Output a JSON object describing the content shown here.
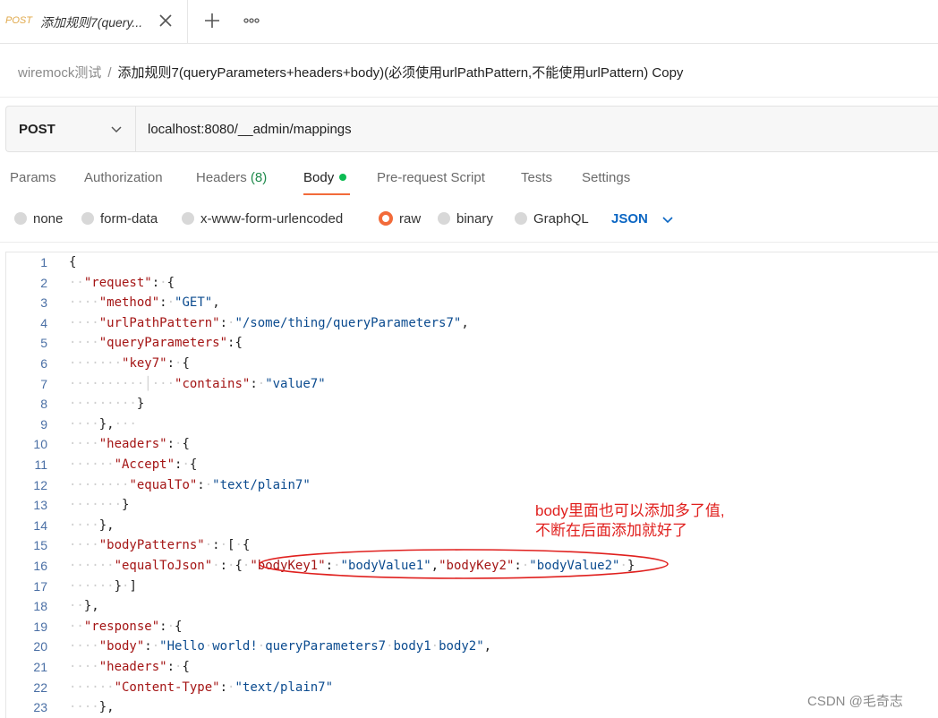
{
  "tab": {
    "method": "POST",
    "title": "添加规则7(query..."
  },
  "icons": {
    "close": "close-icon",
    "new_tab": "plus-icon",
    "more": "more-icon"
  },
  "breadcrumb": {
    "parent": "wiremock测试",
    "separator": "/",
    "current": "添加规则7(queryParameters+headers+body)(必须使用urlPathPattern,不能使用urlPattern) Copy"
  },
  "request": {
    "method": "POST",
    "url": "localhost:8080/__admin/mappings"
  },
  "request_tabs": [
    {
      "label": "Params"
    },
    {
      "label": "Authorization"
    },
    {
      "label": "Headers",
      "count": "(8)"
    },
    {
      "label": "Body"
    },
    {
      "label": "Pre-request Script"
    },
    {
      "label": "Tests"
    },
    {
      "label": "Settings"
    }
  ],
  "body_types": [
    "none",
    "form-data",
    "x-www-form-urlencoded",
    "raw",
    "binary",
    "GraphQL"
  ],
  "body_type_selected": "raw",
  "language": "JSON",
  "colors": {
    "accent": "#f26b3a",
    "active_dot": "#0cbb52",
    "json_key": "#a41515",
    "json_string": "#0b4b8f",
    "annotation": "#e0201e"
  },
  "code_lines": [
    {
      "n": "1",
      "ind": "",
      "html": "{"
    },
    {
      "n": "2",
      "ind": "··",
      "html": "<span class='k'>\"request\"</span>:·{"
    },
    {
      "n": "3",
      "ind": "····",
      "html": "<span class='k'>\"method\"</span>:·<span class='s'>\"GET\"</span>,"
    },
    {
      "n": "4",
      "ind": "····",
      "html": "<span class='k'>\"urlPathPattern\"</span>:·<span class='s'>\"/some/thing/queryParameters7\"</span>,"
    },
    {
      "n": "5",
      "ind": "····",
      "html": "<span class='k'>\"queryParameters\"</span>:{"
    },
    {
      "n": "6",
      "ind": "·······",
      "html": "<span class='k'>\"key7\"</span>:·{"
    },
    {
      "n": "7",
      "ind": "··········│···",
      "html": "<span class='k'>\"contains\"</span>:·<span class='s'>\"value7\"</span>"
    },
    {
      "n": "8",
      "ind": "·········",
      "html": "}"
    },
    {
      "n": "9",
      "ind": "····",
      "html": "},···"
    },
    {
      "n": "10",
      "ind": "····",
      "html": "<span class='k'>\"headers\"</span>:·{"
    },
    {
      "n": "11",
      "ind": "······",
      "html": "<span class='k'>\"Accept\"</span>:·{"
    },
    {
      "n": "12",
      "ind": "········",
      "html": "<span class='k'>\"equalTo\"</span>:·<span class='s'>\"text/plain7\"</span>"
    },
    {
      "n": "13",
      "ind": "·······",
      "html": "}"
    },
    {
      "n": "14",
      "ind": "····",
      "html": "},"
    },
    {
      "n": "15",
      "ind": "····",
      "html": "<span class='k'>\"bodyPatterns\"</span>·:·[·{"
    },
    {
      "n": "16",
      "ind": "······",
      "html": "<span class='k'>\"equalToJson\"</span>·:·{·<span class='k'>\"bodyKey1\"</span>:·<span class='s'>\"bodyValue1\"</span>,<span class='k'>\"bodyKey2\"</span>:·<span class='s'>\"bodyValue2\"</span>·}"
    },
    {
      "n": "17",
      "ind": "······",
      "html": "}·]"
    },
    {
      "n": "18",
      "ind": "··",
      "html": "},"
    },
    {
      "n": "19",
      "ind": "··",
      "html": "<span class='k'>\"response\"</span>:·{"
    },
    {
      "n": "20",
      "ind": "····",
      "html": "<span class='k'>\"body\"</span>:·<span class='s'>\"Hello·world!·queryParameters7·body1·body2\"</span>,"
    },
    {
      "n": "21",
      "ind": "····",
      "html": "<span class='k'>\"headers\"</span>:·{"
    },
    {
      "n": "22",
      "ind": "······",
      "html": "<span class='k'>\"Content-Type\"</span>:·<span class='s'>\"text/plain7\"</span>"
    },
    {
      "n": "23",
      "ind": "····",
      "html": "},"
    }
  ],
  "annotation": {
    "line1": "body里面也可以添加多了值,",
    "line2": "不断在后面添加就好了"
  },
  "watermark": "CSDN @毛奇志"
}
